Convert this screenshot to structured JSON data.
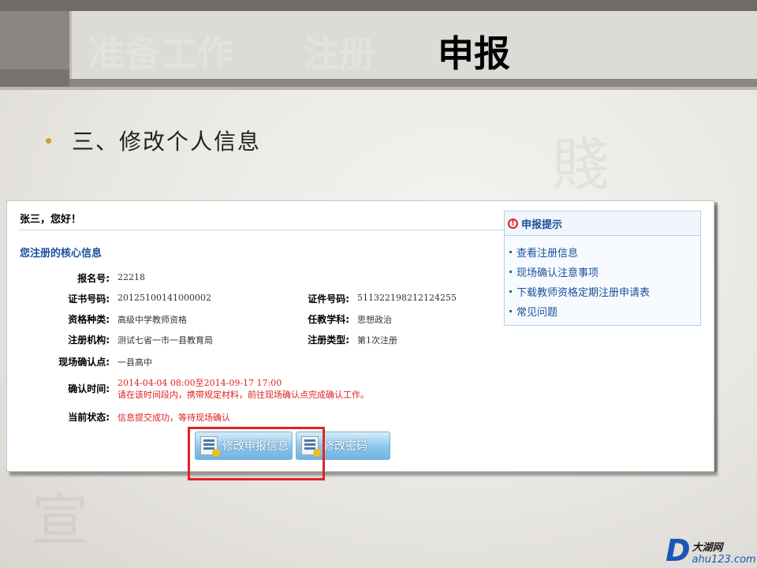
{
  "header": {
    "tabs": [
      {
        "label": "准备工作",
        "active": false
      },
      {
        "label": "注册",
        "active": false
      },
      {
        "label": "申报",
        "active": true
      }
    ]
  },
  "slide": {
    "bullet": "三、修改个人信息"
  },
  "screen": {
    "greeting": "张三，您好！",
    "section_title": "您注册的核心信息",
    "fields": {
      "reg_no": {
        "label": "报名号:",
        "value": "22218"
      },
      "cert_no": {
        "label": "证书号码:",
        "value": "20125100141000002"
      },
      "id_no": {
        "label": "证件号码:",
        "value": "511322198212124255"
      },
      "qual_type": {
        "label": "资格种类:",
        "value": "高级中学教师资格"
      },
      "subject": {
        "label": "任教学科:",
        "value": "思想政治"
      },
      "agency": {
        "label": "注册机构:",
        "value": "测试七省一市一县教育局"
      },
      "reg_type": {
        "label": "注册类型:",
        "value": "第1次注册"
      },
      "site": {
        "label": "现场确认点:",
        "value": "一县高中"
      },
      "confirm_time": {
        "label": "确认时间:",
        "value": "2014-04-04 08:00至2014-09-17 17:00",
        "note": "请在该时间段内，携带规定材料，前往现场确认点完成确认工作。"
      },
      "status": {
        "label": "当前状态:",
        "value": "信息提交成功，等待现场确认"
      }
    },
    "buttons": {
      "modify_info": "修改申报信息",
      "modify_password": "修改密码"
    },
    "tips": {
      "title": "申报提示",
      "items": [
        "查看注册信息",
        "现场确认注意事项",
        "下载教师资格定期注册申请表",
        "常见问题"
      ]
    }
  },
  "watermark": {
    "cn": "大湖网",
    "en": "ahu123.com",
    "letter": "D"
  },
  "colors": {
    "accent_blue": "#1a4f9c",
    "alert_red": "#e02020",
    "highlight_red": "#e52222",
    "bullet_gold": "#c9a227"
  }
}
